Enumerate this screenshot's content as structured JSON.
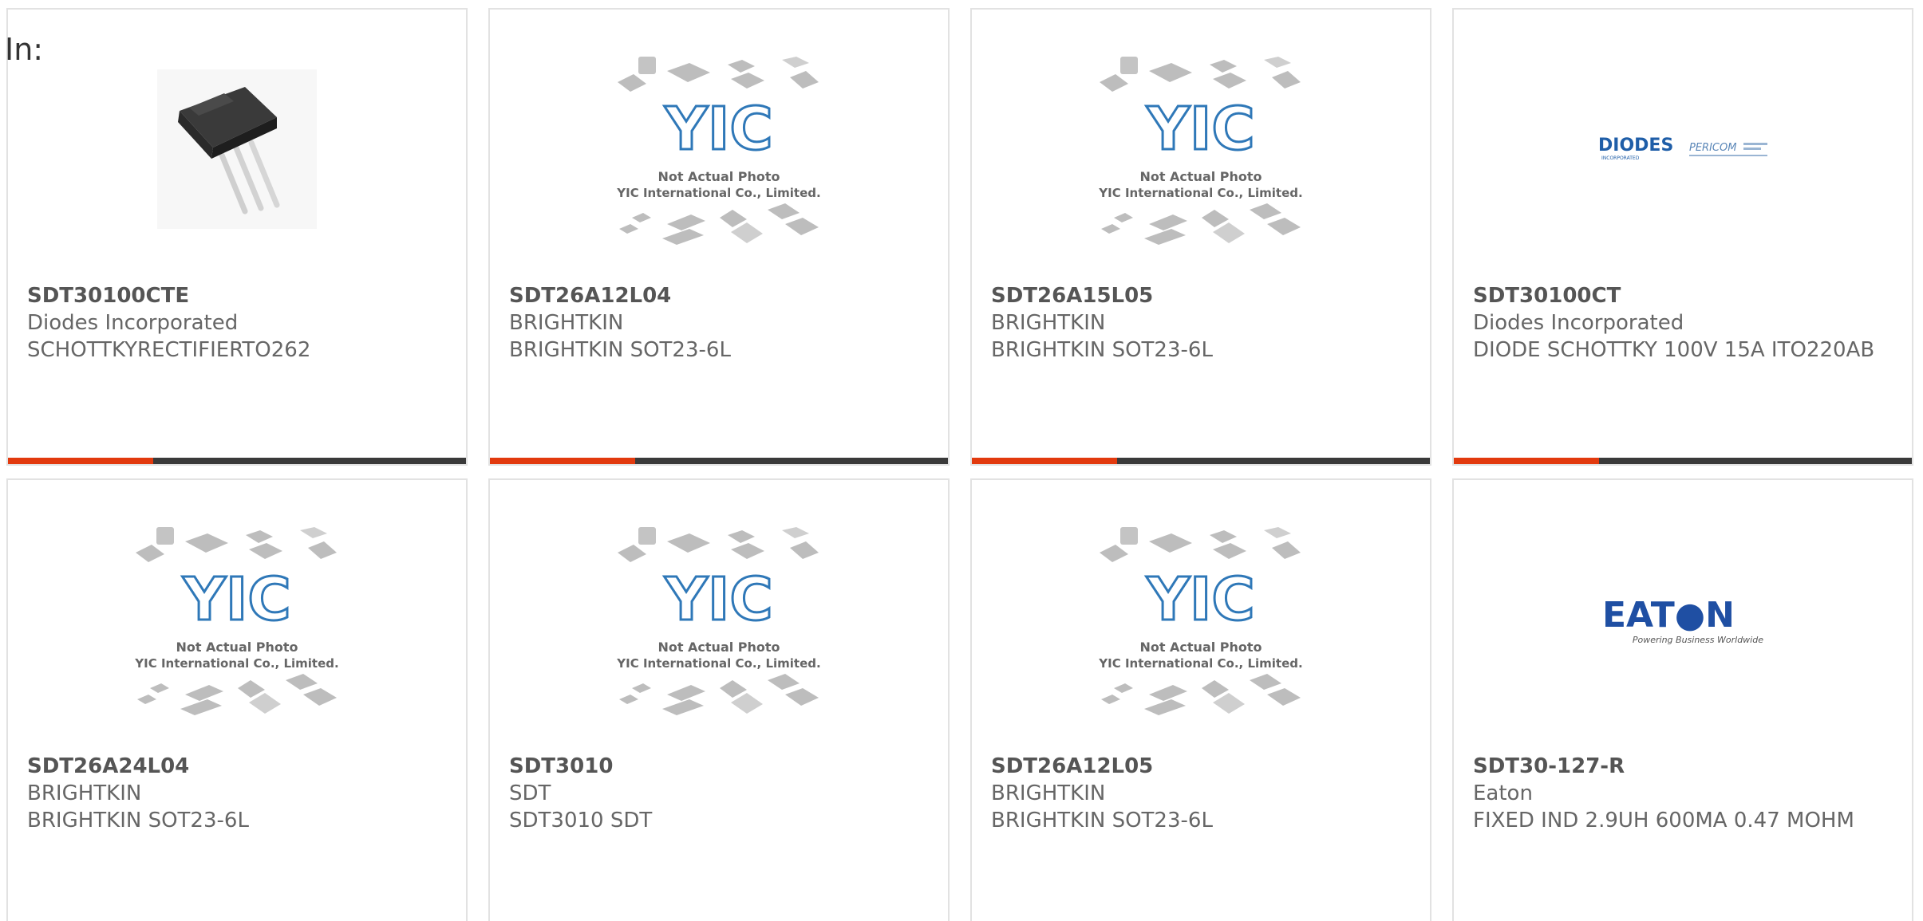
{
  "filter_label": "In:",
  "colors": {
    "accent": "#e23a0e",
    "bar": "#3a3a3a",
    "yic_blue": "#2f78b8",
    "diodes_blue": "#1f5ea8",
    "eaton_blue": "#1f4fa3"
  },
  "products": [
    {
      "part": "SDT30100CTE",
      "manufacturer": "Diodes Incorporated",
      "description": "SCHOTTKYRECTIFIERTO262",
      "image": "transistor-photo"
    },
    {
      "part": "SDT26A12L04",
      "manufacturer": "BRIGHTKIN",
      "description": "BRIGHTKIN SOT23-6L",
      "image": "yic-placeholder"
    },
    {
      "part": "SDT26A15L05",
      "manufacturer": "BRIGHTKIN",
      "description": "BRIGHTKIN SOT23-6L",
      "image": "yic-placeholder"
    },
    {
      "part": "SDT30100CT",
      "manufacturer": "Diodes Incorporated",
      "description": "DIODE SCHOTTKY 100V 15A ITO220AB",
      "image": "diodes-logo"
    },
    {
      "part": "SDT26A24L04",
      "manufacturer": "BRIGHTKIN",
      "description": "BRIGHTKIN SOT23-6L",
      "image": "yic-placeholder"
    },
    {
      "part": "SDT3010",
      "manufacturer": "SDT",
      "description": "SDT3010 SDT",
      "image": "yic-placeholder"
    },
    {
      "part": "SDT26A12L05",
      "manufacturer": "BRIGHTKIN",
      "description": "BRIGHTKIN SOT23-6L",
      "image": "yic-placeholder"
    },
    {
      "part": "SDT30-127-R",
      "manufacturer": "Eaton",
      "description": "FIXED IND 2.9UH 600MA 0.47 MOHM",
      "image": "eaton-logo"
    }
  ],
  "image_text": {
    "yic_logo": "YIC",
    "yic_line1": "Not Actual Photo",
    "yic_line2": "YIC International Co., Limited.",
    "diodes_logo": "DIODES",
    "diodes_sub": "INCORPORATED",
    "pericom_logo": "PERICOM",
    "eaton_logo": "EAT●N",
    "eaton_tagline": "Powering Business Worldwide"
  }
}
